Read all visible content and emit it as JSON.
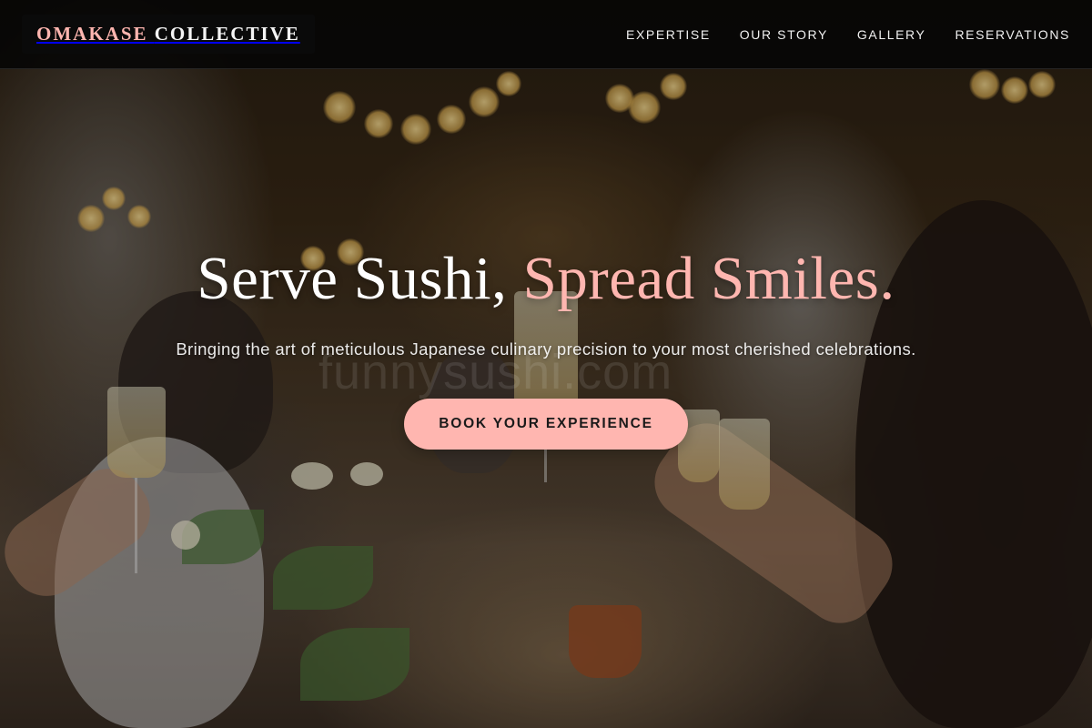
{
  "brand": {
    "name_part1": "OMAKASE",
    "name_part2": "COLLECTIVE"
  },
  "nav": {
    "items": [
      {
        "label": "EXPERTISE"
      },
      {
        "label": "OUR STORY"
      },
      {
        "label": "GALLERY"
      },
      {
        "label": "RESERVATIONS"
      }
    ]
  },
  "hero": {
    "headline_part1": "Serve Sushi,",
    "headline_part2": "Spread Smiles.",
    "subheadline": "Bringing the art of meticulous Japanese culinary precision to your most cherished celebrations.",
    "cta_label": "BOOK YOUR EXPERIENCE",
    "background_image": "people-toasting-at-banquet-photo"
  },
  "watermark": "funnysushi.com",
  "colors": {
    "accent": "#ffb6b0",
    "nav_background": "#050505",
    "text_light": "#ffffff",
    "cta_text": "#1a1a1a"
  }
}
